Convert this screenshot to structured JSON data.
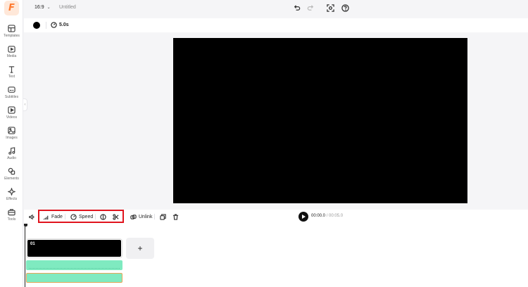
{
  "app": {
    "logo_letter": "F",
    "brand_color": "#ff7a2f"
  },
  "sidebar": {
    "items": [
      {
        "label": "Templates",
        "icon": "layout-icon"
      },
      {
        "label": "Media",
        "icon": "media-icon"
      },
      {
        "label": "Text",
        "icon": "text-icon"
      },
      {
        "label": "Subtitles",
        "icon": "subtitles-icon"
      },
      {
        "label": "Videos",
        "icon": "video-icon"
      },
      {
        "label": "Images",
        "icon": "image-icon"
      },
      {
        "label": "Audio",
        "icon": "music-icon"
      },
      {
        "label": "Elements",
        "icon": "shapes-icon"
      },
      {
        "label": "Effects",
        "icon": "sparkle-icon"
      },
      {
        "label": "Tools",
        "icon": "toolbox-icon"
      }
    ]
  },
  "topbar": {
    "aspect_ratio": "16:9",
    "project_title": "Untitled"
  },
  "properties": {
    "background_color": "#000000",
    "duration": "5.0s"
  },
  "canvas": {
    "background": "#000000"
  },
  "controls": {
    "fade_label": "Fade",
    "speed_label": "Speed",
    "unlink_label": "Unlink",
    "current_time": "00:00.0",
    "separator": " / ",
    "total_time": "00:05.0",
    "highlight_color": "#e0141e"
  },
  "timeline": {
    "clips": [
      {
        "number": "01"
      }
    ],
    "add_scene_label": "+",
    "audio_track_color": "#7feac0"
  }
}
